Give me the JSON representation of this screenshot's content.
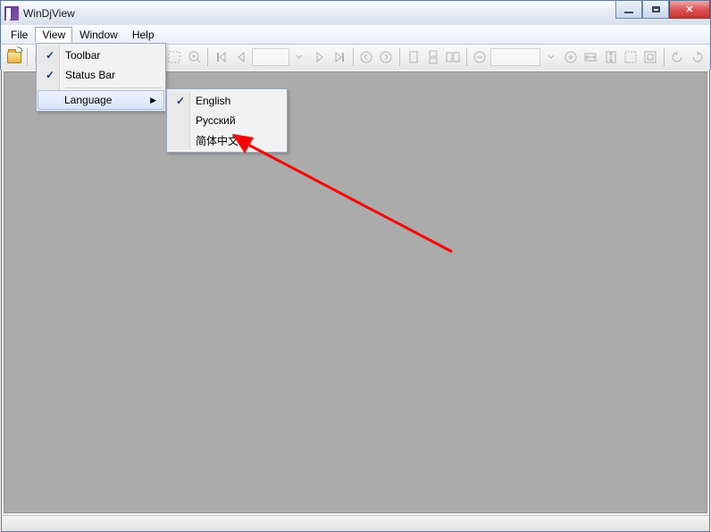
{
  "window": {
    "title": "WinDjView"
  },
  "menubar": {
    "file": "File",
    "view": "View",
    "window": "Window",
    "help": "Help"
  },
  "viewMenu": {
    "toolbar": "Toolbar",
    "statusbar": "Status Bar",
    "language": "Language"
  },
  "languageMenu": {
    "english": "English",
    "russian": "Русский",
    "chinese": "简体中文"
  },
  "icons": {
    "open": "open-icon",
    "print": "print-icon",
    "export": "export-icon",
    "find": "find-icon",
    "info": "info-icon",
    "select": "select-icon",
    "hand": "hand-icon",
    "marquee": "marquee-icon",
    "loupe": "loupe-icon",
    "first": "first-page-icon",
    "prev": "prev-page-icon",
    "next": "next-page-icon",
    "last": "last-page-icon",
    "back": "view-back-icon",
    "forward": "view-forward-icon",
    "single": "single-page-icon",
    "continuous": "continuous-icon",
    "facing": "facing-icon",
    "zoomout": "zoom-out-icon",
    "zoomin": "zoom-in-icon",
    "rotleft": "rotate-left-icon",
    "rotright": "rotate-right-icon",
    "fitwidth": "fit-width-icon",
    "fitpage": "fit-page-icon",
    "actual": "actual-size-icon",
    "stretch": "stretch-icon"
  }
}
